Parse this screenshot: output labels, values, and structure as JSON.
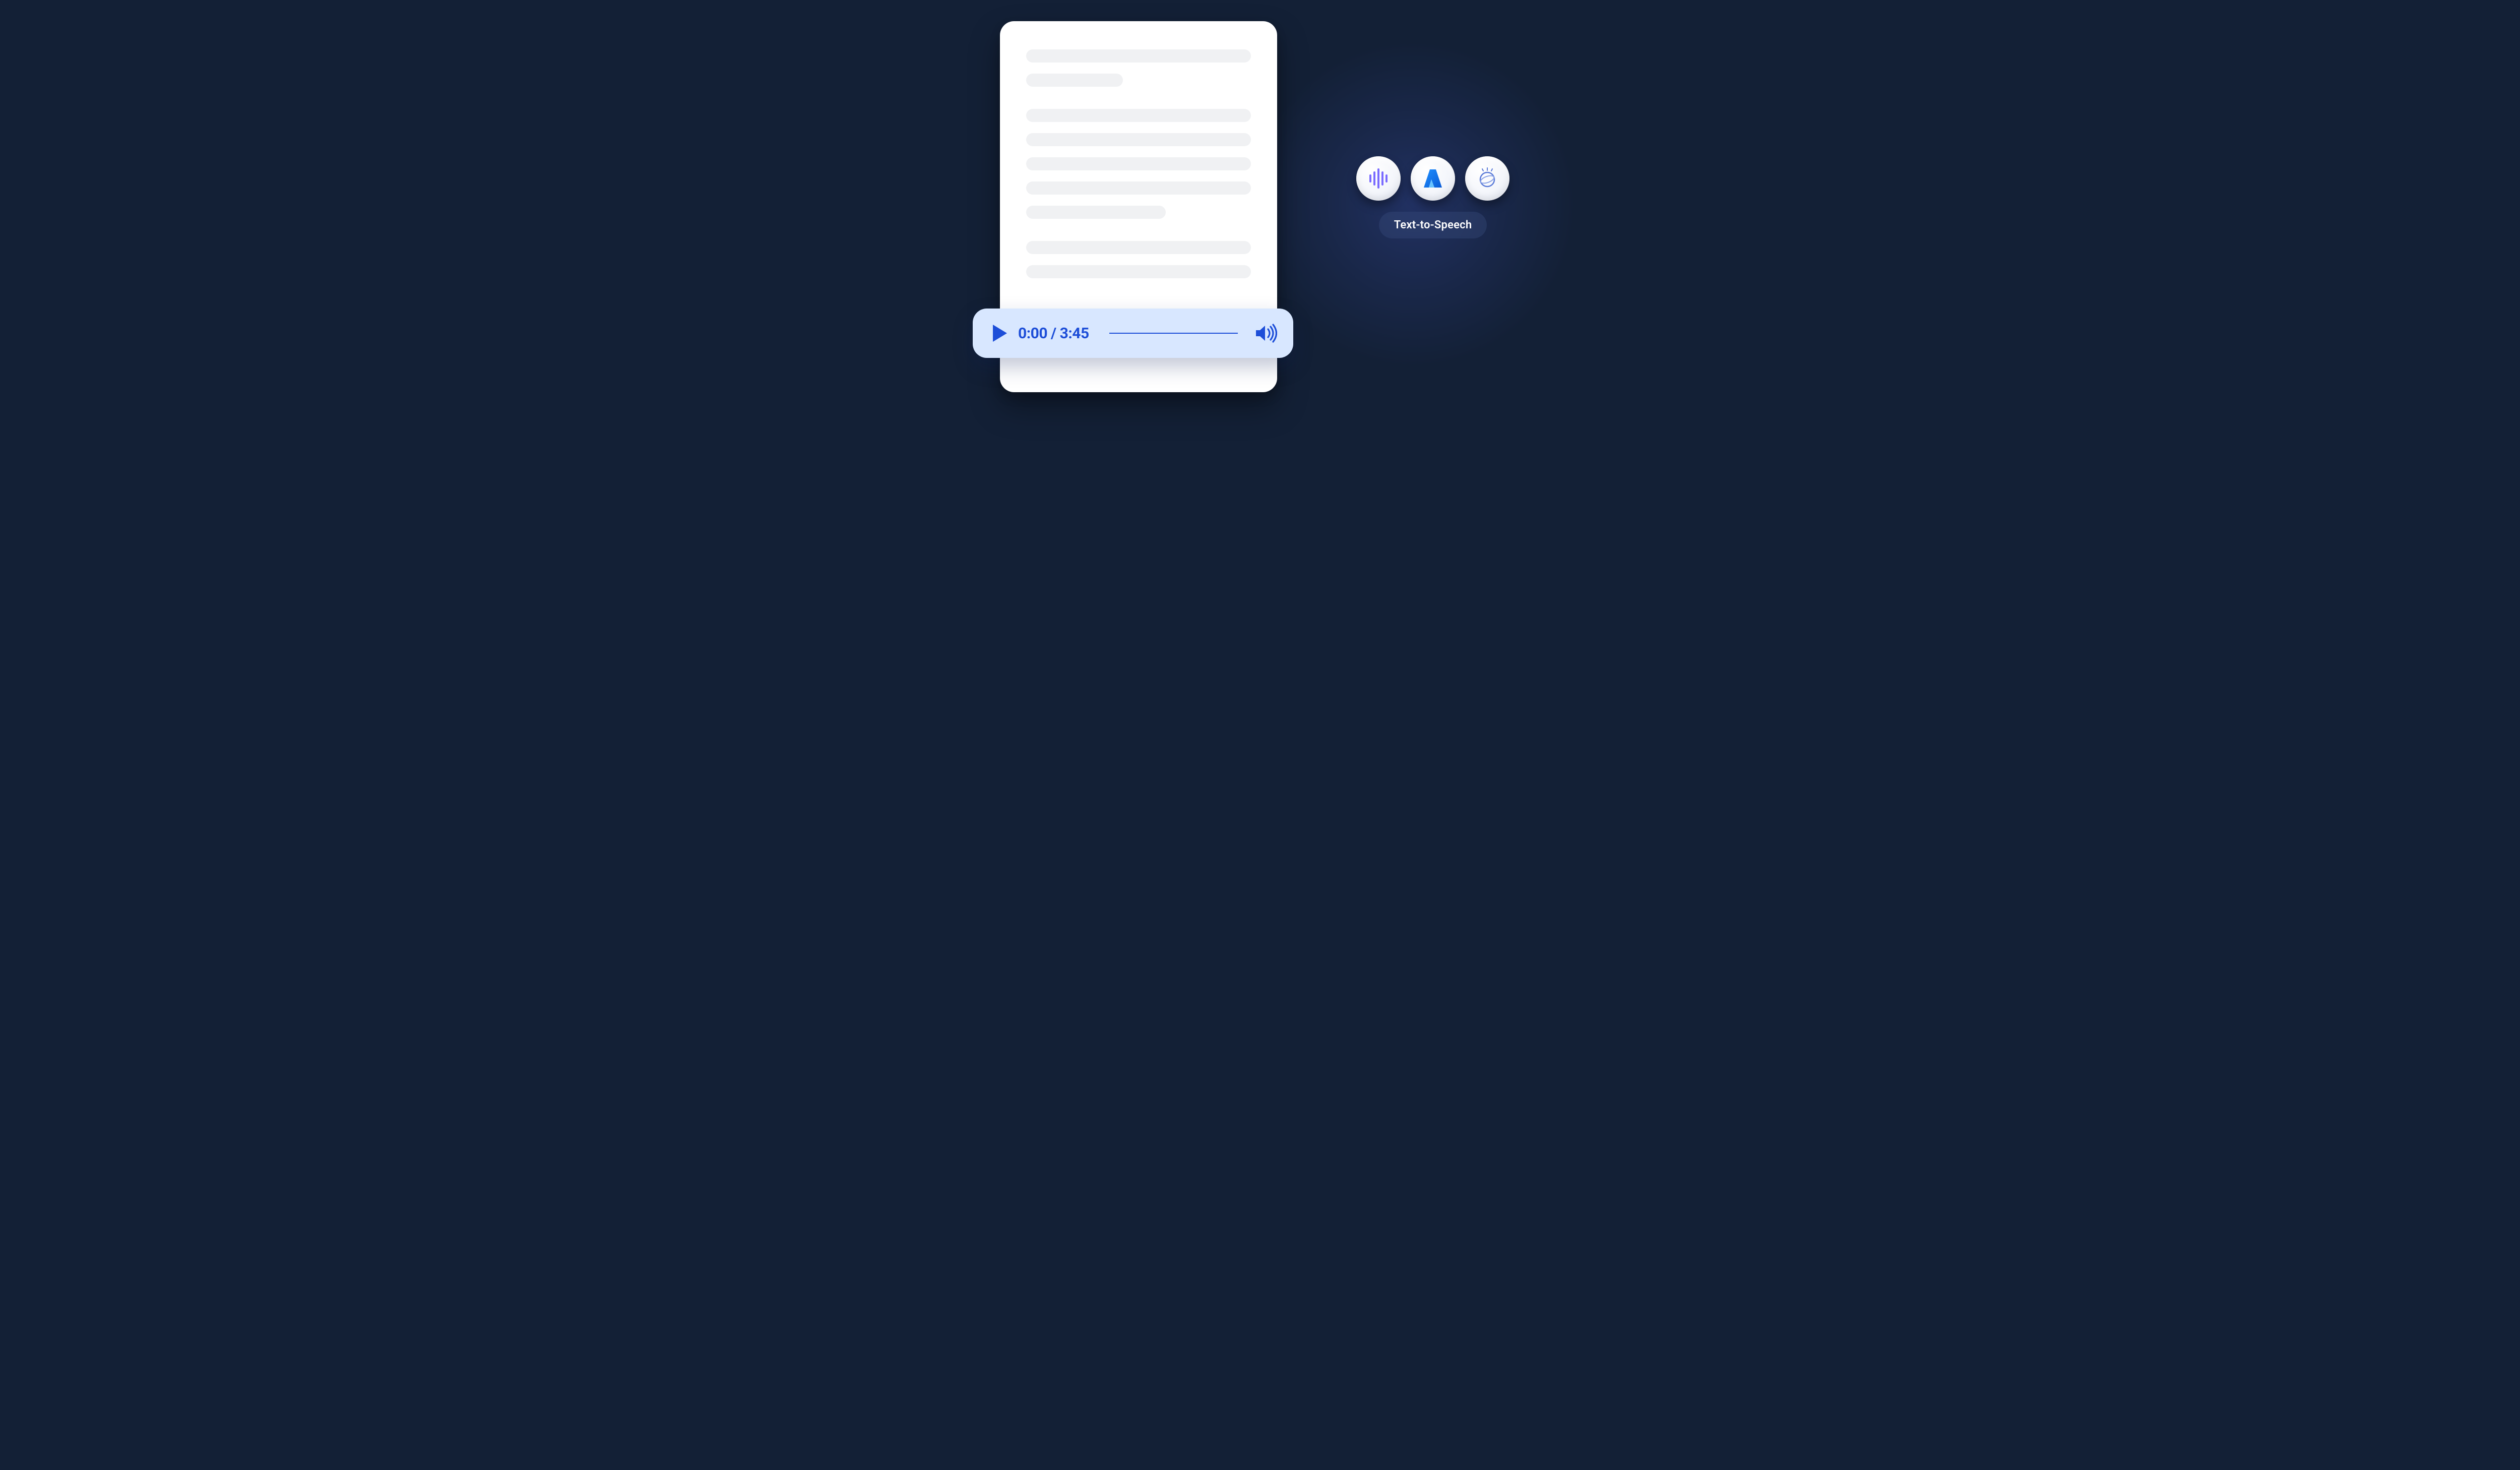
{
  "player": {
    "current_time": "0:00",
    "separator": " / ",
    "total_time": "3:45"
  },
  "services": {
    "label": "Text-to-Speech",
    "icons": [
      {
        "name": "waveform-icon"
      },
      {
        "name": "azure-icon"
      },
      {
        "name": "watson-icon"
      }
    ]
  },
  "document": {
    "paragraphs": [
      {
        "lines": [
          "w100",
          "w43"
        ]
      },
      {
        "lines": [
          "w100",
          "w100",
          "w100",
          "w100",
          "w62"
        ]
      },
      {
        "lines": [
          "w100",
          "w100"
        ]
      }
    ]
  },
  "colors": {
    "bg": "#132036",
    "playerBg": "#d8e7ff",
    "accent": "#1d4ed8",
    "docBg": "#ffffff",
    "lineFill": "#f0f1f3"
  }
}
